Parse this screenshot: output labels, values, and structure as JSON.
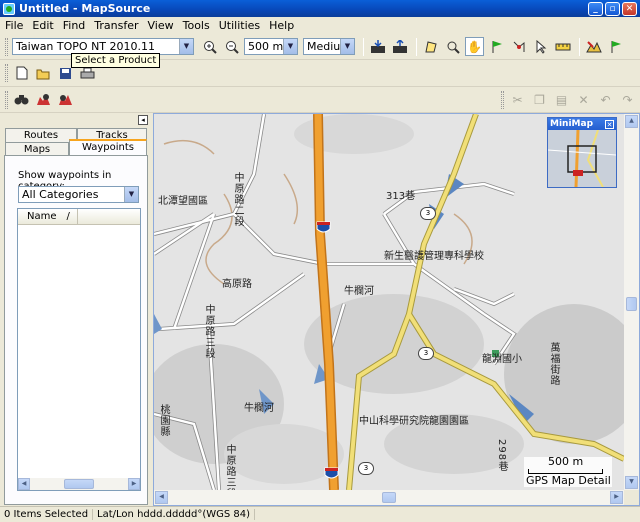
{
  "window": {
    "title": "Untitled - MapSource"
  },
  "menu": [
    "File",
    "Edit",
    "Find",
    "Transfer",
    "View",
    "Tools",
    "Utilities",
    "Help"
  ],
  "toolbar": {
    "product": "Taiwan TOPO NT 2010.11",
    "tooltip": "Select a Product",
    "zoom_scale": "500 m",
    "detail": "Medium"
  },
  "left_panel": {
    "tabs": [
      "Routes",
      "Tracks",
      "Maps",
      "Waypoints"
    ],
    "active_tab": "Waypoints",
    "category_label": "Show waypoints in category:",
    "category_value": "All Categories",
    "list_column": "Name",
    "sort_indicator": "/"
  },
  "map": {
    "labels": [
      "北潭望國區",
      "中原路二段",
      "高原路",
      "中原路三段",
      "313巷",
      "新生醫護管理專科學校",
      "牛欄河",
      "龍淵國小",
      "萬福街路",
      "桃園縣",
      "牛欄河",
      "中山科學研究院龍園園區",
      "298巷",
      "中原路三段"
    ],
    "route_shields": [
      "3",
      "3",
      "3",
      "3"
    ],
    "minimap_title": "MiniMap",
    "scale": "500 m",
    "detail_text": "GPS Map Detail"
  },
  "status": {
    "selection": "0 Items Selected",
    "coords": "Lat/Lon hddd.ddddd°(WGS 84)"
  }
}
